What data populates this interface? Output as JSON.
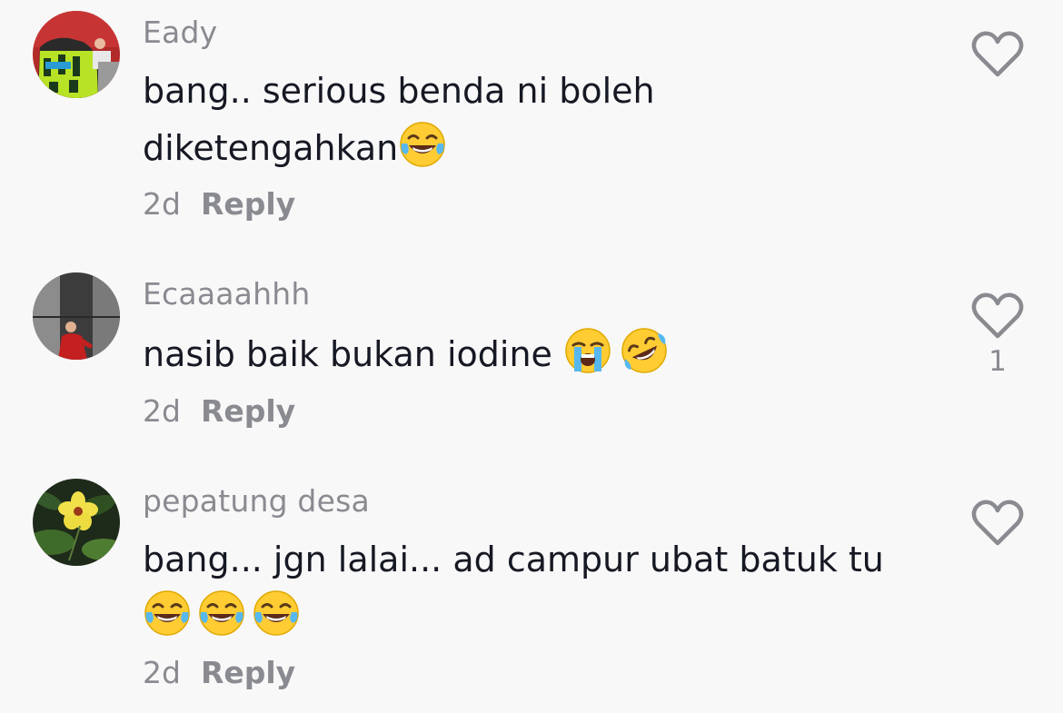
{
  "comments": [
    {
      "username": "Eady",
      "text_line1": "bang.. serious benda ni boleh",
      "text_line2": "diketengahkan",
      "time": "2d",
      "reply_label": "Reply",
      "likes": ""
    },
    {
      "username": "Ecaaaahhh",
      "text_line1": "nasib baik bukan iodine ",
      "time": "2d",
      "reply_label": "Reply",
      "likes": "1"
    },
    {
      "username": "pepatung desa",
      "text_line1": "bang... jgn lalai... ad campur ubat batuk tu",
      "time": "2d",
      "reply_label": "Reply",
      "likes": ""
    }
  ],
  "icons": {
    "like": "heart-outline-icon",
    "emoji_laugh": "face-with-tears-of-joy",
    "emoji_cry": "loudly-crying-face",
    "emoji_rofl": "rolling-on-floor-laughing"
  }
}
